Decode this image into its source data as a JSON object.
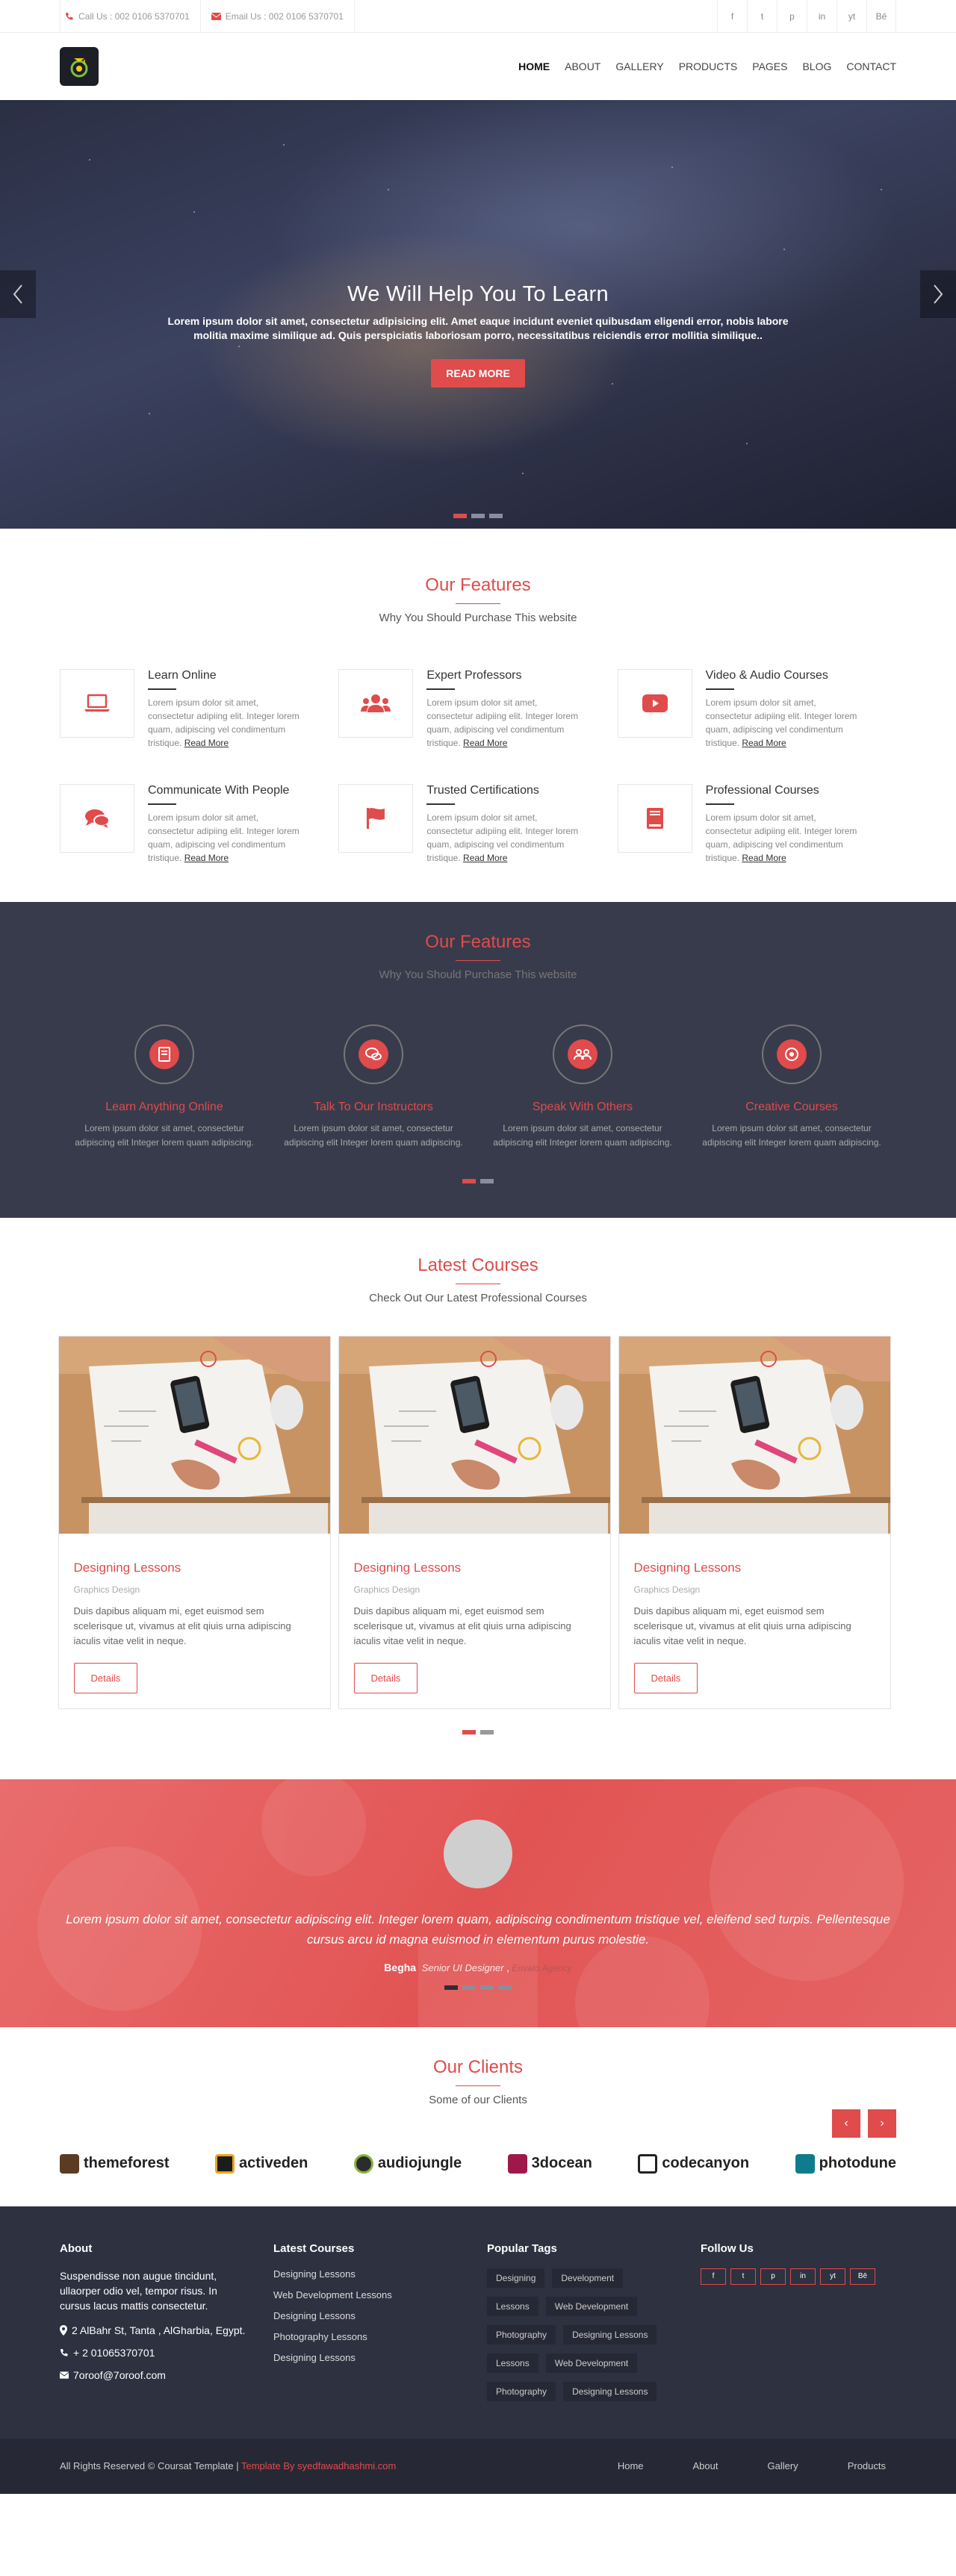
{
  "topbar": {
    "call": "Call Us : 002 0106 5370701",
    "email": "Email Us : 002 0106 5370701",
    "social": [
      "f",
      "t",
      "p",
      "in",
      "yt",
      "Bē"
    ]
  },
  "nav": [
    "HOME",
    "ABOUT",
    "GALLERY",
    "PRODUCTS",
    "PAGES",
    "BLOG",
    "CONTACT"
  ],
  "hero": {
    "title": "We Will Help You To Learn",
    "text": "Lorem ipsum dolor sit amet, consectetur adipisicing elit. Amet eaque incidunt eveniet quibusdam eligendi error, nobis labore molitia maxime similique ad. Quis perspiciatis laboriosam porro, necessitatibus reiciendis error mollitia similique..",
    "button": "READ MORE"
  },
  "features": {
    "title": "Our Features",
    "subtitle": "Why You Should Purchase This website",
    "read_more": "Read More",
    "items": [
      {
        "title": "Learn Online",
        "text": "Lorem ipsum dolor sit amet, consectetur adipiing elit. Integer lorem quam, adipiscing vel condimentum tristique.",
        "icon": "laptop-icon"
      },
      {
        "title": "Expert Professors",
        "text": "Lorem ipsum dolor sit amet, consectetur adipiing elit. Integer lorem quam, adipiscing vel condimentum tristique.",
        "icon": "users-icon"
      },
      {
        "title": "Video & Audio Courses",
        "text": "Lorem ipsum dolor sit amet, consectetur adipiing elit. Integer lorem quam, adipiscing vel condimentum tristique.",
        "icon": "youtube-icon"
      },
      {
        "title": "Communicate With People",
        "text": "Lorem ipsum dolor sit amet, consectetur adipiing elit. Integer lorem quam, adipiscing vel condimentum tristique.",
        "icon": "chat-icon"
      },
      {
        "title": "Trusted Certifications",
        "text": "Lorem ipsum dolor sit amet, consectetur adipiing elit. Integer lorem quam, adipiscing vel condimentum tristique.",
        "icon": "flag-icon"
      },
      {
        "title": "Professional Courses",
        "text": "Lorem ipsum dolor sit amet, consectetur adipiing elit. Integer lorem quam, adipiscing vel condimentum tristique.",
        "icon": "book-icon"
      }
    ]
  },
  "features2": {
    "title": "Our Features",
    "subtitle": "Why You Should Purchase This website",
    "items": [
      {
        "title": "Learn Anything Online",
        "text": "Lorem ipsum dolor sit amet, consectetur adipiscing elit Integer lorem quam adipiscing.",
        "icon": "book-icon"
      },
      {
        "title": "Talk To Our Instructors",
        "text": "Lorem ipsum dolor sit amet, consectetur adipiscing elit Integer lorem quam adipiscing.",
        "icon": "chat-icon"
      },
      {
        "title": "Speak With Others",
        "text": "Lorem ipsum dolor sit amet, consectetur adipiscing elit Integer lorem quam adipiscing.",
        "icon": "users-icon"
      },
      {
        "title": "Creative Courses",
        "text": "Lorem ipsum dolor sit amet, consectetur adipiscing elit Integer lorem quam adipiscing.",
        "icon": "target-icon"
      }
    ]
  },
  "courses": {
    "title": "Latest Courses",
    "subtitle": "Check Out Our Latest Professional Courses",
    "items": [
      {
        "title": "Designing Lessons",
        "category": "Graphics Design",
        "text": "Duis dapibus aliquam mi, eget euismod sem scelerisque ut, vivamus at elit qiuis urna adipiscing iaculis vitae velit in neque.",
        "button": "Details"
      },
      {
        "title": "Designing Lessons",
        "category": "Graphics Design",
        "text": "Duis dapibus aliquam mi, eget euismod sem scelerisque ut, vivamus at elit qiuis urna adipiscing iaculis vitae velit in neque.",
        "button": "Details"
      },
      {
        "title": "Designing Lessons",
        "category": "Graphics Design",
        "text": "Duis dapibus aliquam mi, eget euismod sem scelerisque ut, vivamus at elit qiuis urna adipiscing iaculis vitae velit in neque.",
        "button": "Details"
      }
    ]
  },
  "testimonial": {
    "quote": "Lorem ipsum dolor sit amet, consectetur adipiscing elit. Integer lorem quam, adipiscing condimentum tristique vel, eleifend sed turpis. Pellentesque cursus arcu id magna euismod in elementum purus molestie.",
    "name": "Begha",
    "role": "Senior UI Designer",
    "company": "Envato Agency"
  },
  "clients": {
    "title": "Our Clients",
    "subtitle": "Some of our Clients",
    "prev": "‹",
    "next": "›",
    "logos": [
      "themeforest",
      "activeden",
      "audiojungle",
      "3docean",
      "codecanyon",
      "photodune"
    ]
  },
  "footer": {
    "about_title": "About",
    "about_text": "Suspendisse non augue tincidunt, ullaorper odio vel, tempor risus. In cursus lacus mattis consectetur.",
    "address": "2 AlBahr St, Tanta , AlGharbia, Egypt.",
    "phone": "+ 2 01065370701",
    "email": "7oroof@7oroof.com",
    "courses_title": "Latest Courses",
    "courses": [
      "Designing Lessons",
      "Web Development Lessons",
      "Designing Lessons",
      "Photography Lessons",
      "Designing Lessons"
    ],
    "tags_title": "Popular Tags",
    "tags": [
      "Designing",
      "Development",
      "Lessons",
      "Web Development",
      "Photography",
      "Designing Lessons",
      "Lessons",
      "Web Development",
      "Photography",
      "Designing Lessons"
    ],
    "follow_title": "Follow Us",
    "follow": [
      "f",
      "t",
      "p",
      "in",
      "yt",
      "Bē"
    ]
  },
  "copyright": {
    "text": "All Rights Reserved © Coursat Template |",
    "credit": "Template By syedfawadhashmi.com",
    "links": [
      "Home",
      "About",
      "Gallery",
      "Products"
    ]
  },
  "colors": {
    "accent": "#e04b4b",
    "dark": "#383b4b",
    "footer": "#2d3140"
  }
}
